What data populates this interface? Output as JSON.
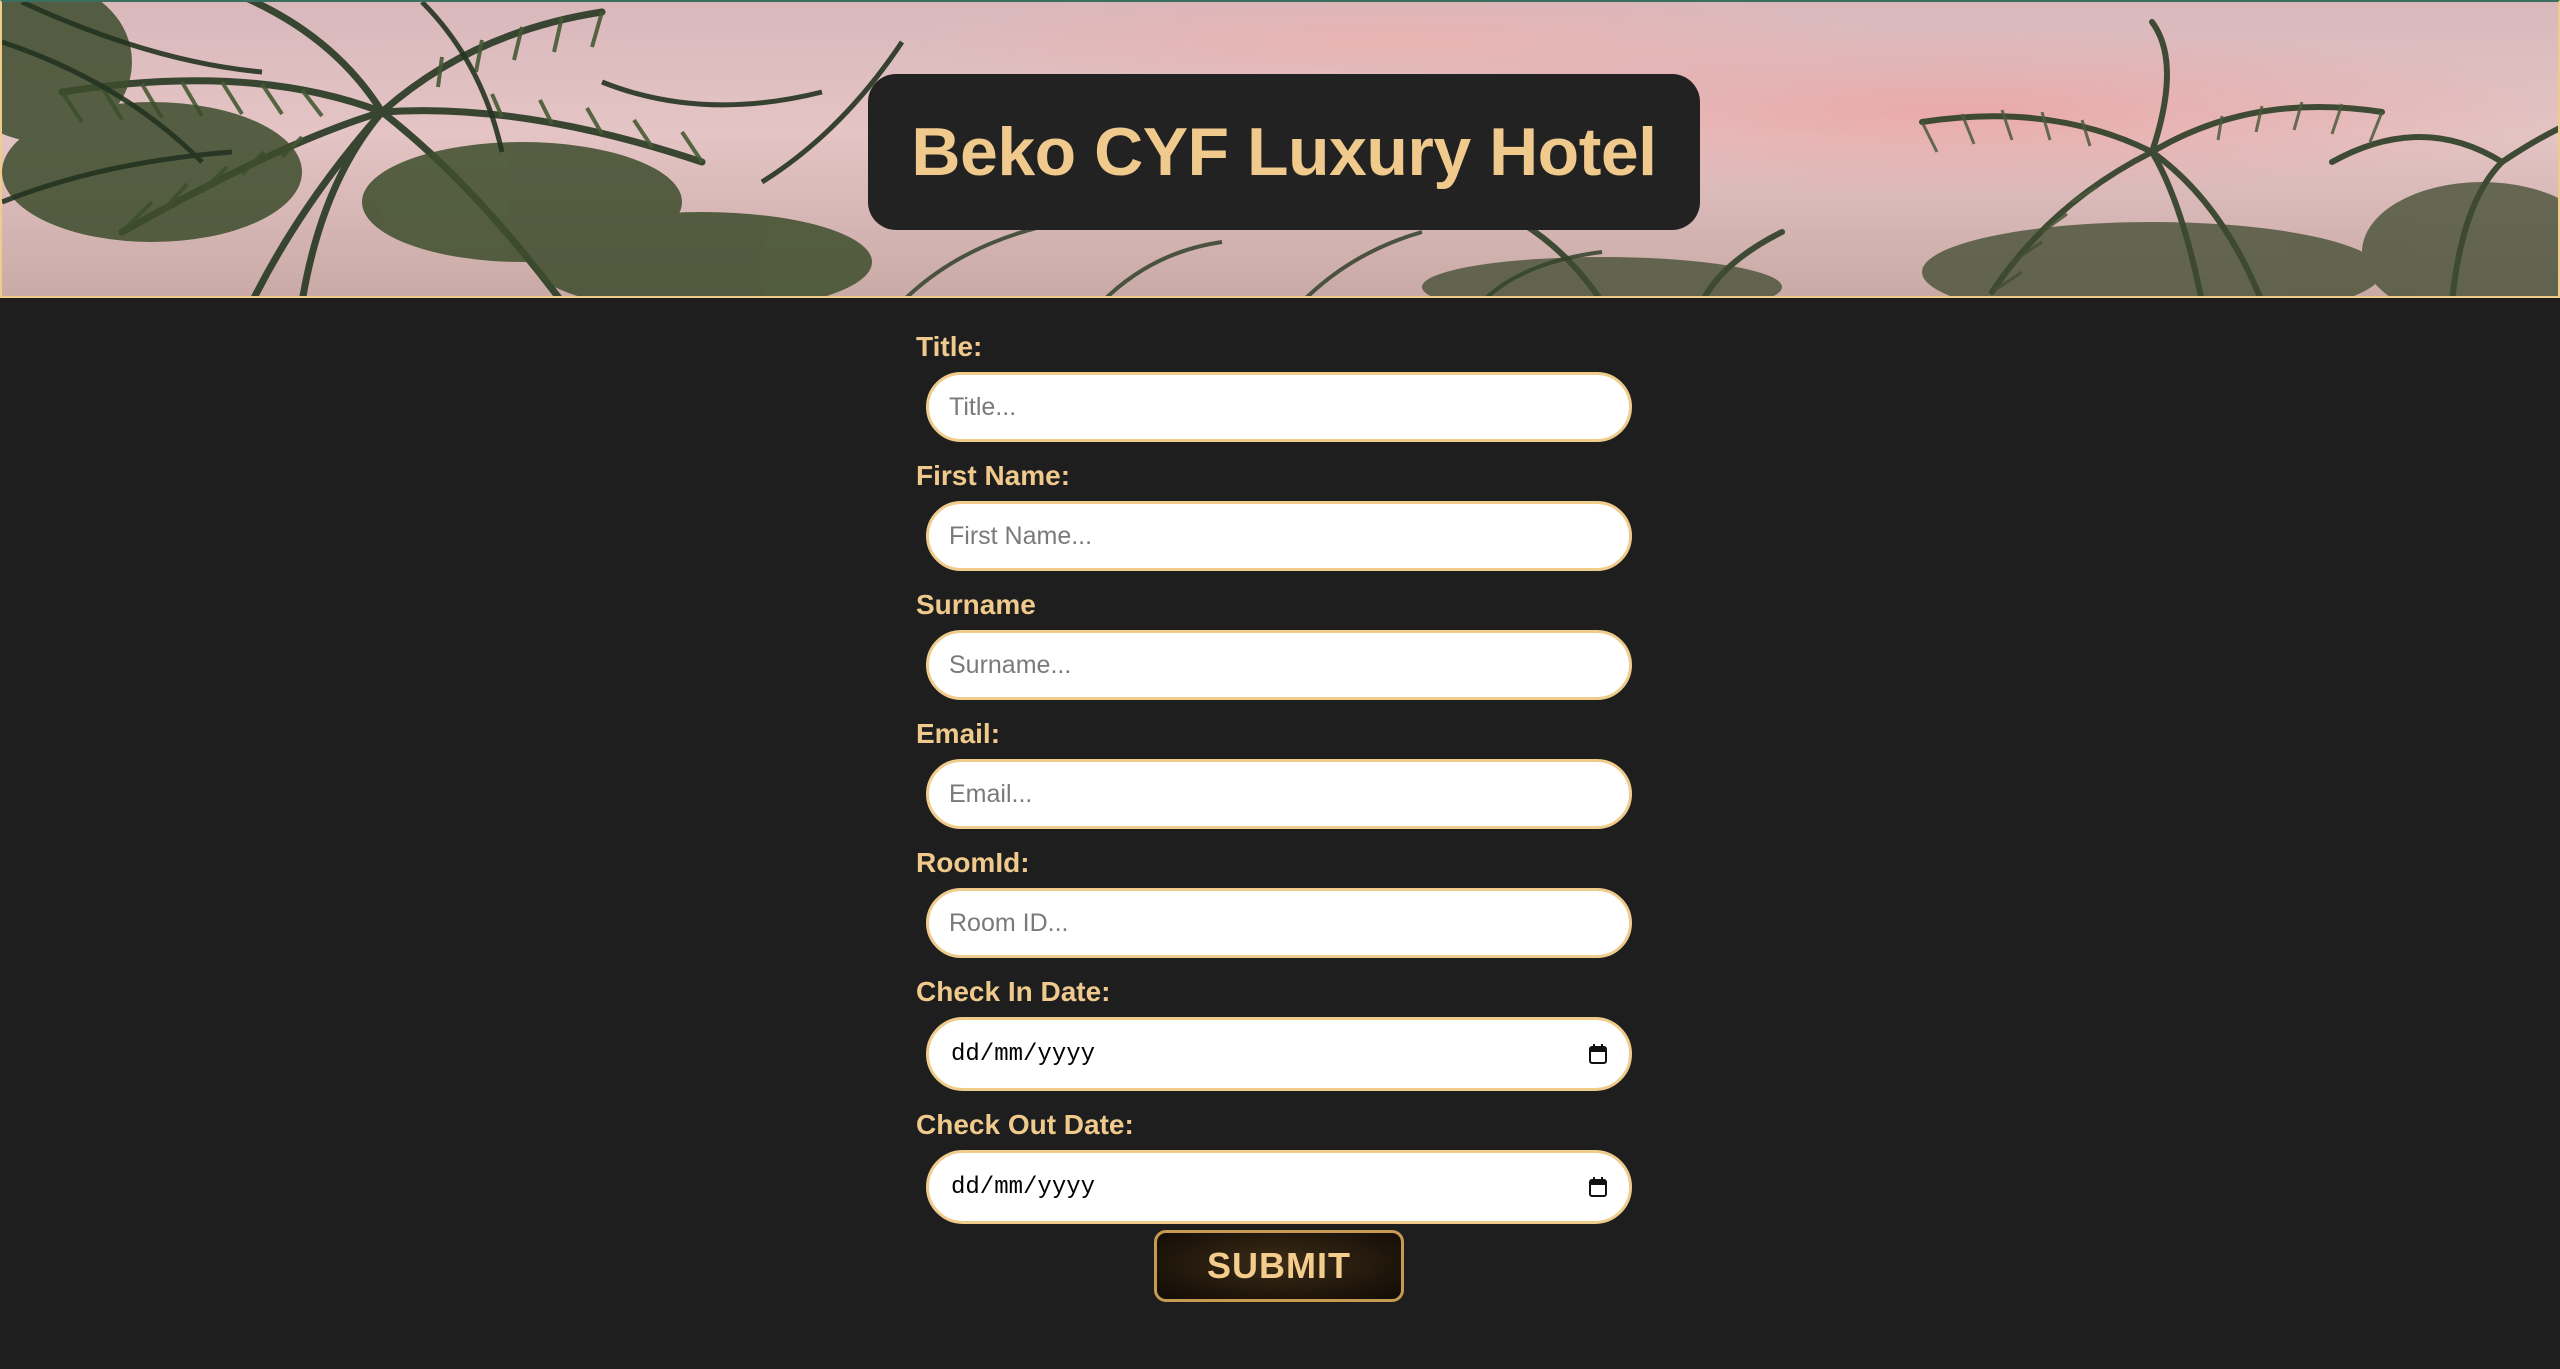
{
  "header": {
    "title": "Beko CYF Luxury Hotel"
  },
  "form": {
    "title": {
      "label": "Title:",
      "placeholder": "Title..."
    },
    "first_name": {
      "label": "First Name:",
      "placeholder": "First Name..."
    },
    "surname": {
      "label": "Surname",
      "placeholder": "Surname..."
    },
    "email": {
      "label": "Email:",
      "placeholder": "Email..."
    },
    "room_id": {
      "label": "RoomId:",
      "placeholder": "Room ID..."
    },
    "check_in": {
      "label": "Check In Date:",
      "value": "dd/mm/yyyy",
      "icon": "calendar-icon"
    },
    "check_out": {
      "label": "Check Out Date:",
      "value": "dd/mm/yyyy",
      "icon": "calendar-icon"
    },
    "submit_label": "SUBMIT"
  },
  "colors": {
    "background": "#1e1e1e",
    "accent_gold": "#f0c98c",
    "title_box": "#222222"
  }
}
